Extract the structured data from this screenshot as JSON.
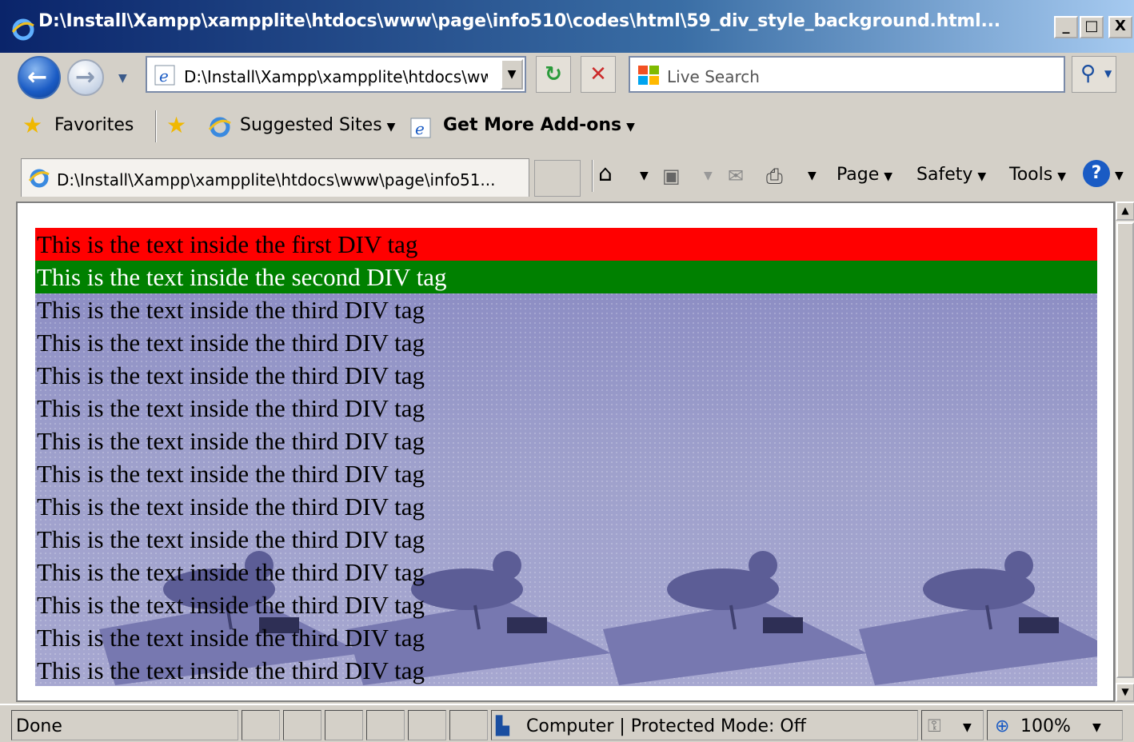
{
  "window": {
    "title": "D:\\Install\\Xampp\\xampplite\\htdocs\\www\\page\\info510\\codes\\html\\59_div_style_background.html...",
    "minimize": "_",
    "maximize": "□",
    "close": "X"
  },
  "nav": {
    "address": "D:\\Install\\Xampp\\xampplite\\htdocs\\ww",
    "search_placeholder": "Live Search"
  },
  "favorites": {
    "favorites_label": "Favorites",
    "suggested_sites": "Suggested Sites",
    "get_addons": "Get More Add-ons"
  },
  "commandbar": {
    "tab_title": "D:\\Install\\Xampp\\xampplite\\htdocs\\www\\page\\info51...",
    "page": "Page",
    "safety": "Safety",
    "tools": "Tools"
  },
  "content": {
    "first_div": "This is the text inside the first DIV tag",
    "second_div": "This is the text inside the second DIV tag",
    "third_div_lines": [
      "This is the text inside the third DIV tag",
      "This is the text inside the third DIV tag",
      "This is the text inside the third DIV tag",
      "This is the text inside the third DIV tag",
      "This is the text inside the third DIV tag",
      "This is the text inside the third DIV tag",
      "This is the text inside the third DIV tag",
      "This is the text inside the third DIV tag",
      "This is the text inside the third DIV tag",
      "This is the text inside the third DIV tag",
      "This is the text inside the third DIV tag",
      "This is the text inside the third DIV tag"
    ],
    "colors": {
      "first": "#ff0000",
      "second": "#008000",
      "third_bg": "#9b9cc8"
    }
  },
  "status": {
    "state": "Done",
    "zone": "Computer | Protected Mode: Off",
    "zoom": "100%"
  }
}
